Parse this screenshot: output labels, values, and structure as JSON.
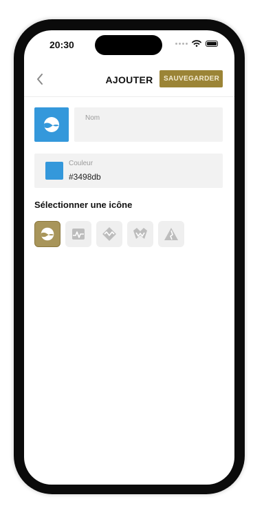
{
  "status": {
    "time": "20:30"
  },
  "header": {
    "title": "AJOUTER",
    "save_label": "SAUVEGARDER"
  },
  "form": {
    "name": {
      "label": "Nom",
      "value": ""
    },
    "color": {
      "label": "Couleur",
      "value": "#3498db"
    }
  },
  "icon_picker": {
    "title": "Sélectionner une icône",
    "options": [
      {
        "icon": "wave-circle-icon",
        "selected": true
      },
      {
        "icon": "pulse-square-icon",
        "selected": false
      },
      {
        "icon": "diamond-wave-icon",
        "selected": false
      },
      {
        "icon": "double-peak-icon",
        "selected": false
      },
      {
        "icon": "mountain-icon",
        "selected": false
      }
    ]
  },
  "colors": {
    "accent": "#9b8436",
    "selected_icon_bg": "#a8955a",
    "chosen_color": "#3498db"
  }
}
